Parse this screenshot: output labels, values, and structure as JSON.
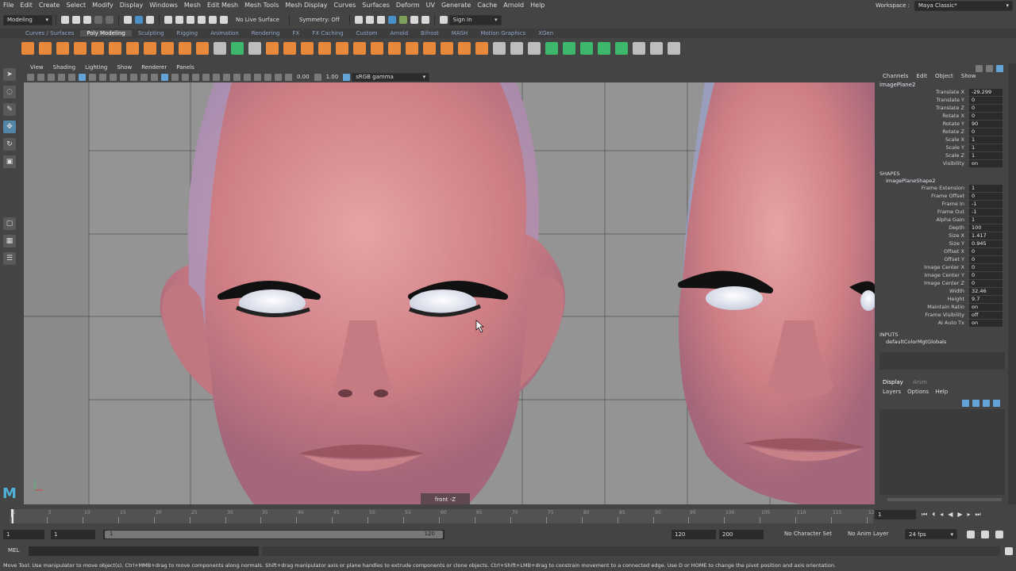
{
  "menus": [
    "File",
    "Edit",
    "Create",
    "Select",
    "Modify",
    "Display",
    "Windows",
    "Mesh",
    "Edit Mesh",
    "Mesh Tools",
    "Mesh Display",
    "Curves",
    "Surfaces",
    "Deform",
    "UV",
    "Generate",
    "Cache",
    "Arnold",
    "Help"
  ],
  "workspace": {
    "label": "Workspace :",
    "value": "Maya Classic*"
  },
  "status": {
    "mode": "Modeling",
    "live_surface": "No Live Surface",
    "symmetry": "Symmetry: Off",
    "sign_in": "Sign In"
  },
  "shelf_tabs": [
    "Curves / Surfaces",
    "Poly Modeling",
    "Sculpting",
    "Rigging",
    "Animation",
    "Rendering",
    "FX",
    "FX Caching",
    "Custom",
    "Arnold",
    "Bifrost",
    "MASH",
    "Motion Graphics",
    "XGen"
  ],
  "shelf_active": "Poly Modeling",
  "panel_menus": [
    "View",
    "Shading",
    "Lighting",
    "Show",
    "Renderer",
    "Panels"
  ],
  "panel_toolbar": {
    "value1": "0.00",
    "value2": "1.00",
    "color_space": "sRGB gamma"
  },
  "viewport": {
    "camera_label": "front -Z",
    "logo": "M"
  },
  "channel_box": {
    "tabs": [
      "Channels",
      "Edit",
      "Object",
      "Show"
    ],
    "object_name": "imagePlane2",
    "attrs": [
      {
        "k": "Translate X",
        "v": "-29.299"
      },
      {
        "k": "Translate Y",
        "v": "0"
      },
      {
        "k": "Translate Z",
        "v": "0"
      },
      {
        "k": "Rotate X",
        "v": "0"
      },
      {
        "k": "Rotate Y",
        "v": "90"
      },
      {
        "k": "Rotate Z",
        "v": "0"
      },
      {
        "k": "Scale X",
        "v": "1"
      },
      {
        "k": "Scale Y",
        "v": "1"
      },
      {
        "k": "Scale Z",
        "v": "1"
      },
      {
        "k": "Visibility",
        "v": "on"
      }
    ],
    "shapes_label": "SHAPES",
    "shape_name": "imagePlaneShape2",
    "shape_attrs": [
      {
        "k": "Frame Extension",
        "v": "1"
      },
      {
        "k": "Frame Offset",
        "v": "0"
      },
      {
        "k": "Frame In",
        "v": "-1"
      },
      {
        "k": "Frame Out",
        "v": "-1"
      },
      {
        "k": "Alpha Gain",
        "v": "1"
      },
      {
        "k": "Depth",
        "v": "100"
      },
      {
        "k": "Size X",
        "v": "1.417"
      },
      {
        "k": "Size Y",
        "v": "0.945"
      },
      {
        "k": "Offset X",
        "v": "0"
      },
      {
        "k": "Offset Y",
        "v": "0"
      },
      {
        "k": "Image Center X",
        "v": "0"
      },
      {
        "k": "Image Center Y",
        "v": "0"
      },
      {
        "k": "Image Center Z",
        "v": "0"
      },
      {
        "k": "Width",
        "v": "32.46"
      },
      {
        "k": "Height",
        "v": "9.7"
      },
      {
        "k": "Maintain Ratio",
        "v": "on"
      },
      {
        "k": "Frame Visibility",
        "v": "off"
      },
      {
        "k": "AI Auto Tx",
        "v": "on"
      }
    ],
    "inputs_label": "INPUTS",
    "input_name": "defaultColorMgtGlobals",
    "layer_tabs": [
      "Display",
      "Anim"
    ],
    "layer_menus": [
      "Layers",
      "Options",
      "Help"
    ]
  },
  "timeline": {
    "ticks": [
      "1",
      "5",
      "10",
      "15",
      "20",
      "25",
      "30",
      "35",
      "40",
      "45",
      "50",
      "55",
      "60",
      "65",
      "70",
      "75",
      "80",
      "85",
      "90",
      "95",
      "100",
      "105",
      "110",
      "115",
      "120"
    ],
    "current_frame": "1"
  },
  "range": {
    "start": "1",
    "inner_start": "1",
    "slider_start": "1",
    "slider_end": "120",
    "inner_end": "120",
    "end": "200",
    "character_set": "No Character Set",
    "anim_layer": "No Anim Layer",
    "fps": "24 fps"
  },
  "command": {
    "label": "MEL"
  },
  "help_text": "Move Tool: Use manipulator to move object(s). Ctrl+MMB+drag to move components along normals. Shift+drag manipulator axis or plane handles to extrude components or clone objects. Ctrl+Shift+LMB+drag to constrain movement to a connected edge. Use D or HOME to change the pivot position and axis orientation.",
  "colors": {
    "accent": "#5285a6",
    "skin": "#d98b8e",
    "bg": "#444444"
  }
}
